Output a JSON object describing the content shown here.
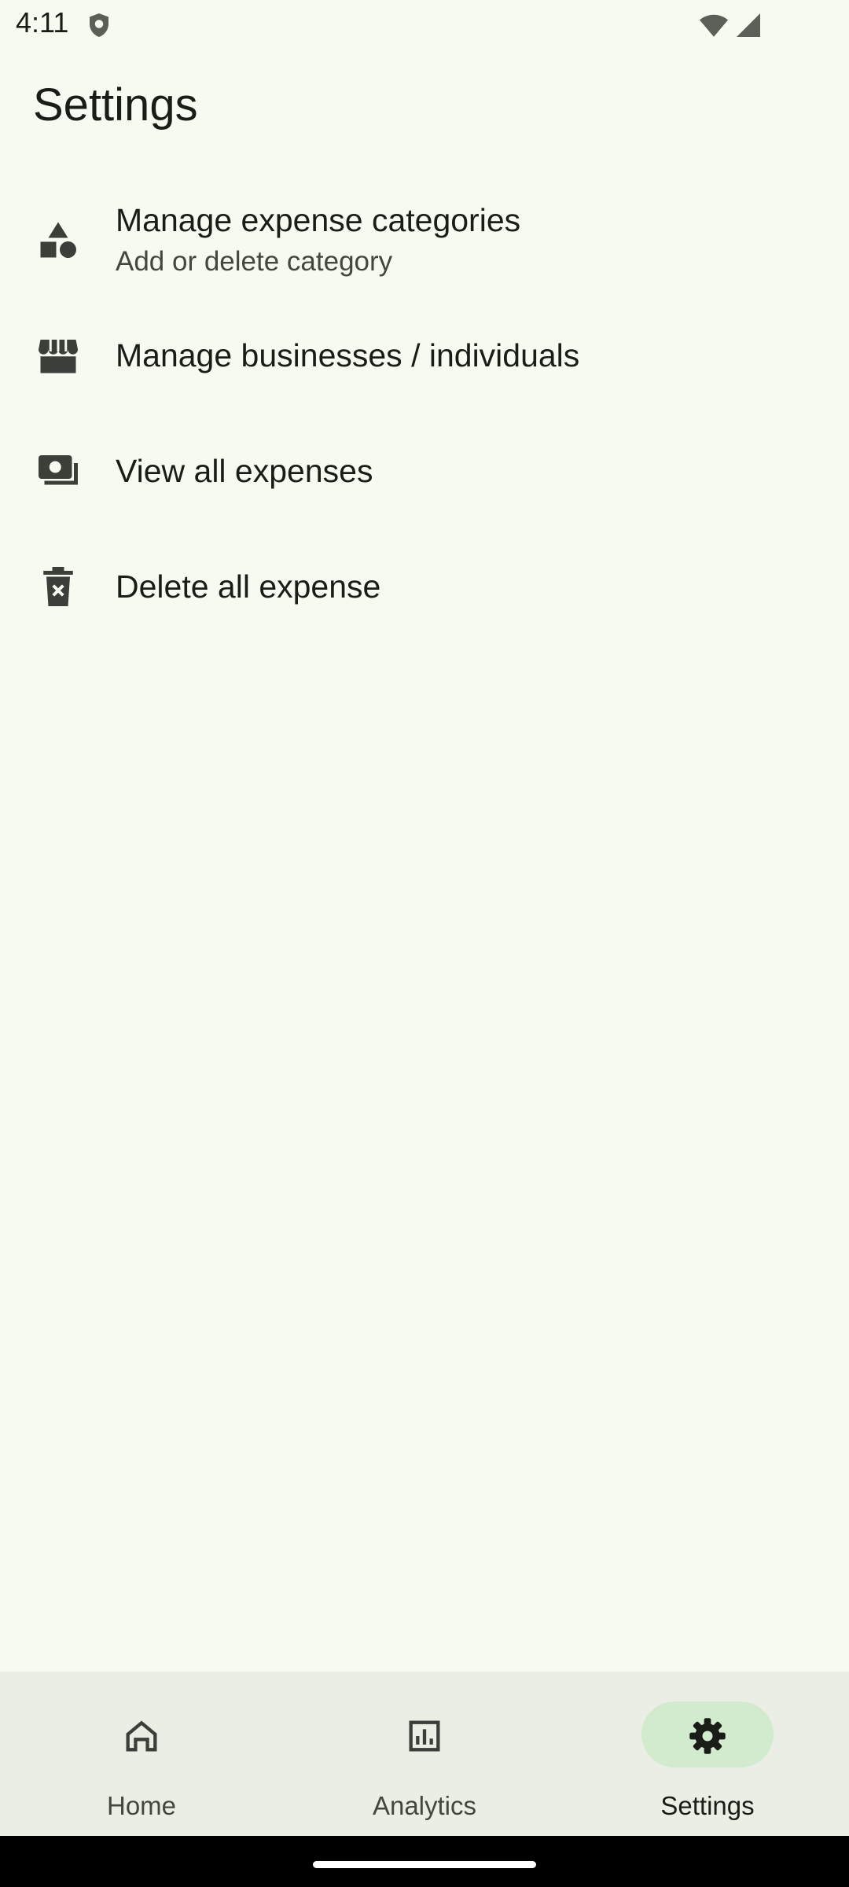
{
  "status_bar": {
    "time": "4:11",
    "icons": [
      "shield-icon",
      "wifi-icon",
      "signal-icon"
    ]
  },
  "header": {
    "title": "Settings"
  },
  "settings": {
    "items": [
      {
        "icon": "shapes-icon",
        "label": "Manage expense categories",
        "sublabel": "Add or delete category"
      },
      {
        "icon": "storefront-icon",
        "label": "Manage businesses / individuals"
      },
      {
        "icon": "payments-icon",
        "label": "View all expenses"
      },
      {
        "icon": "delete-forever-icon",
        "label": "Delete all expense"
      }
    ]
  },
  "bottom_nav": {
    "items": [
      {
        "icon": "home-icon",
        "label": "Home",
        "active": false
      },
      {
        "icon": "analytics-icon",
        "label": "Analytics",
        "active": false
      },
      {
        "icon": "settings-gear-icon",
        "label": "Settings",
        "active": true
      }
    ]
  },
  "colors": {
    "background": "#f7faf1",
    "nav_background": "#ebeee5",
    "active_pill": "#d2ebcf",
    "icon": "#3b3f3a",
    "text": "#1a1c18"
  }
}
